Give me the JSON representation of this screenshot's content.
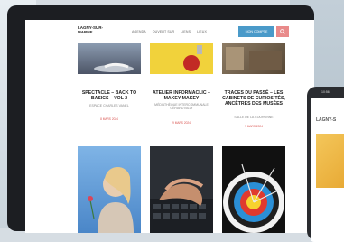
{
  "site": {
    "logo": "LAGNY-SUR-MARNE",
    "menu": [
      "AGENDA",
      "OUVERT SUR",
      "LIENS",
      "LIEUX"
    ],
    "nav_button": "MON COMPTE"
  },
  "cards": [
    {
      "title": "SPECTACLE – BACK TO BASICS – VOL 2",
      "subtitle": "ESPACE CHARLES VANEL",
      "date": "8 MARS 2024"
    },
    {
      "title": "ATELIER INFORMACLIC – MAKEY MAKEY",
      "subtitle": "MÉDIATHÈQUE INTERCOMMUNALE GÉRARD BILLY",
      "date": "9 MARS 2024"
    },
    {
      "title": "TRACES DU PASSÉ – LES CABINETS DE CURIOSITÉS, ANCÊTRES DES MUSÉES",
      "subtitle": "SALLE DE LA COURONNE",
      "date": "9 MARS 2024"
    }
  ],
  "phone": {
    "status_time": "10:56",
    "logo": "LAGNY-S"
  },
  "icons": {
    "search": "search-icon"
  }
}
